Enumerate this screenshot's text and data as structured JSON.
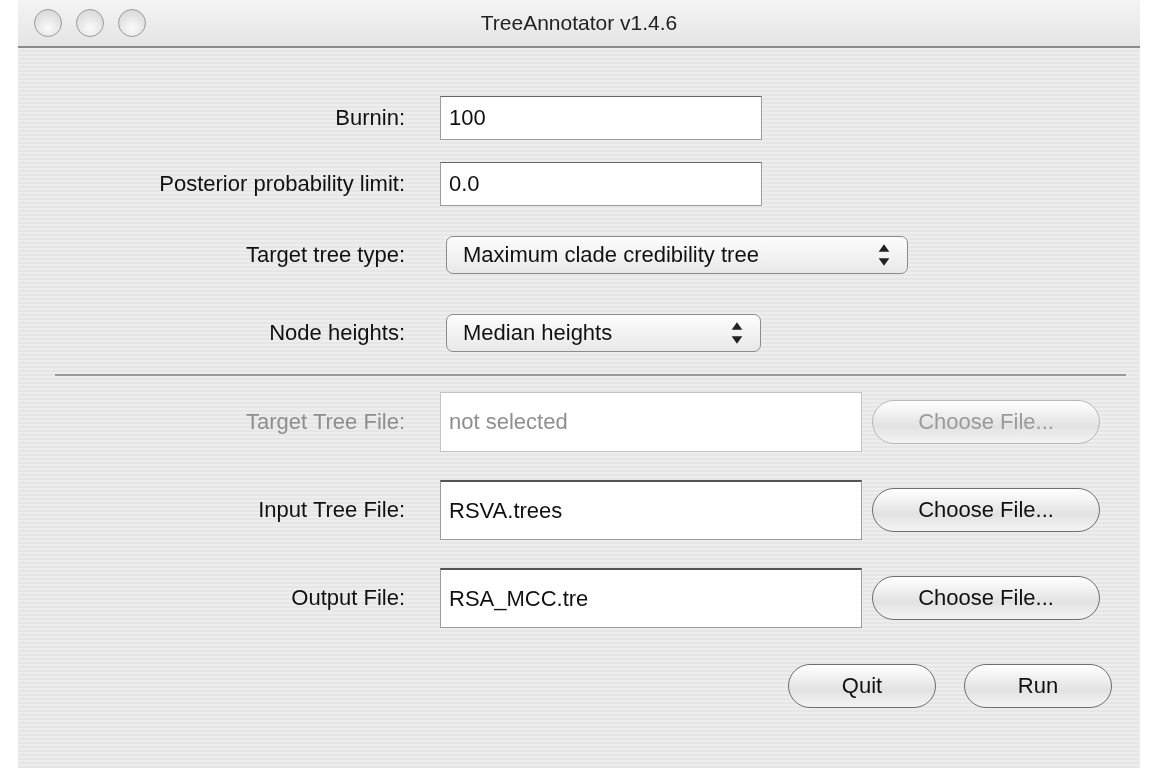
{
  "window": {
    "title": "TreeAnnotator v1.4.6"
  },
  "settings": [
    {
      "kind": "text",
      "label": "Burnin:",
      "value": "100"
    },
    {
      "kind": "text",
      "label": "Posterior probability limit:",
      "value": "0.0"
    },
    {
      "kind": "select",
      "label": "Target tree type:",
      "value": "Maximum clade credibility tree"
    },
    {
      "kind": "select",
      "label": "Node heights:",
      "value": "Median heights"
    }
  ],
  "files": [
    {
      "label": "Target Tree File:",
      "value": "not selected",
      "button": "Choose File...",
      "disabled": true
    },
    {
      "label": "Input Tree File:",
      "value": "RSVA.trees",
      "button": "Choose File...",
      "disabled": false
    },
    {
      "label": "Output File:",
      "value": "RSA_MCC.tre",
      "button": "Choose File...",
      "disabled": false
    }
  ],
  "buttons": [
    "Quit",
    "Run"
  ]
}
